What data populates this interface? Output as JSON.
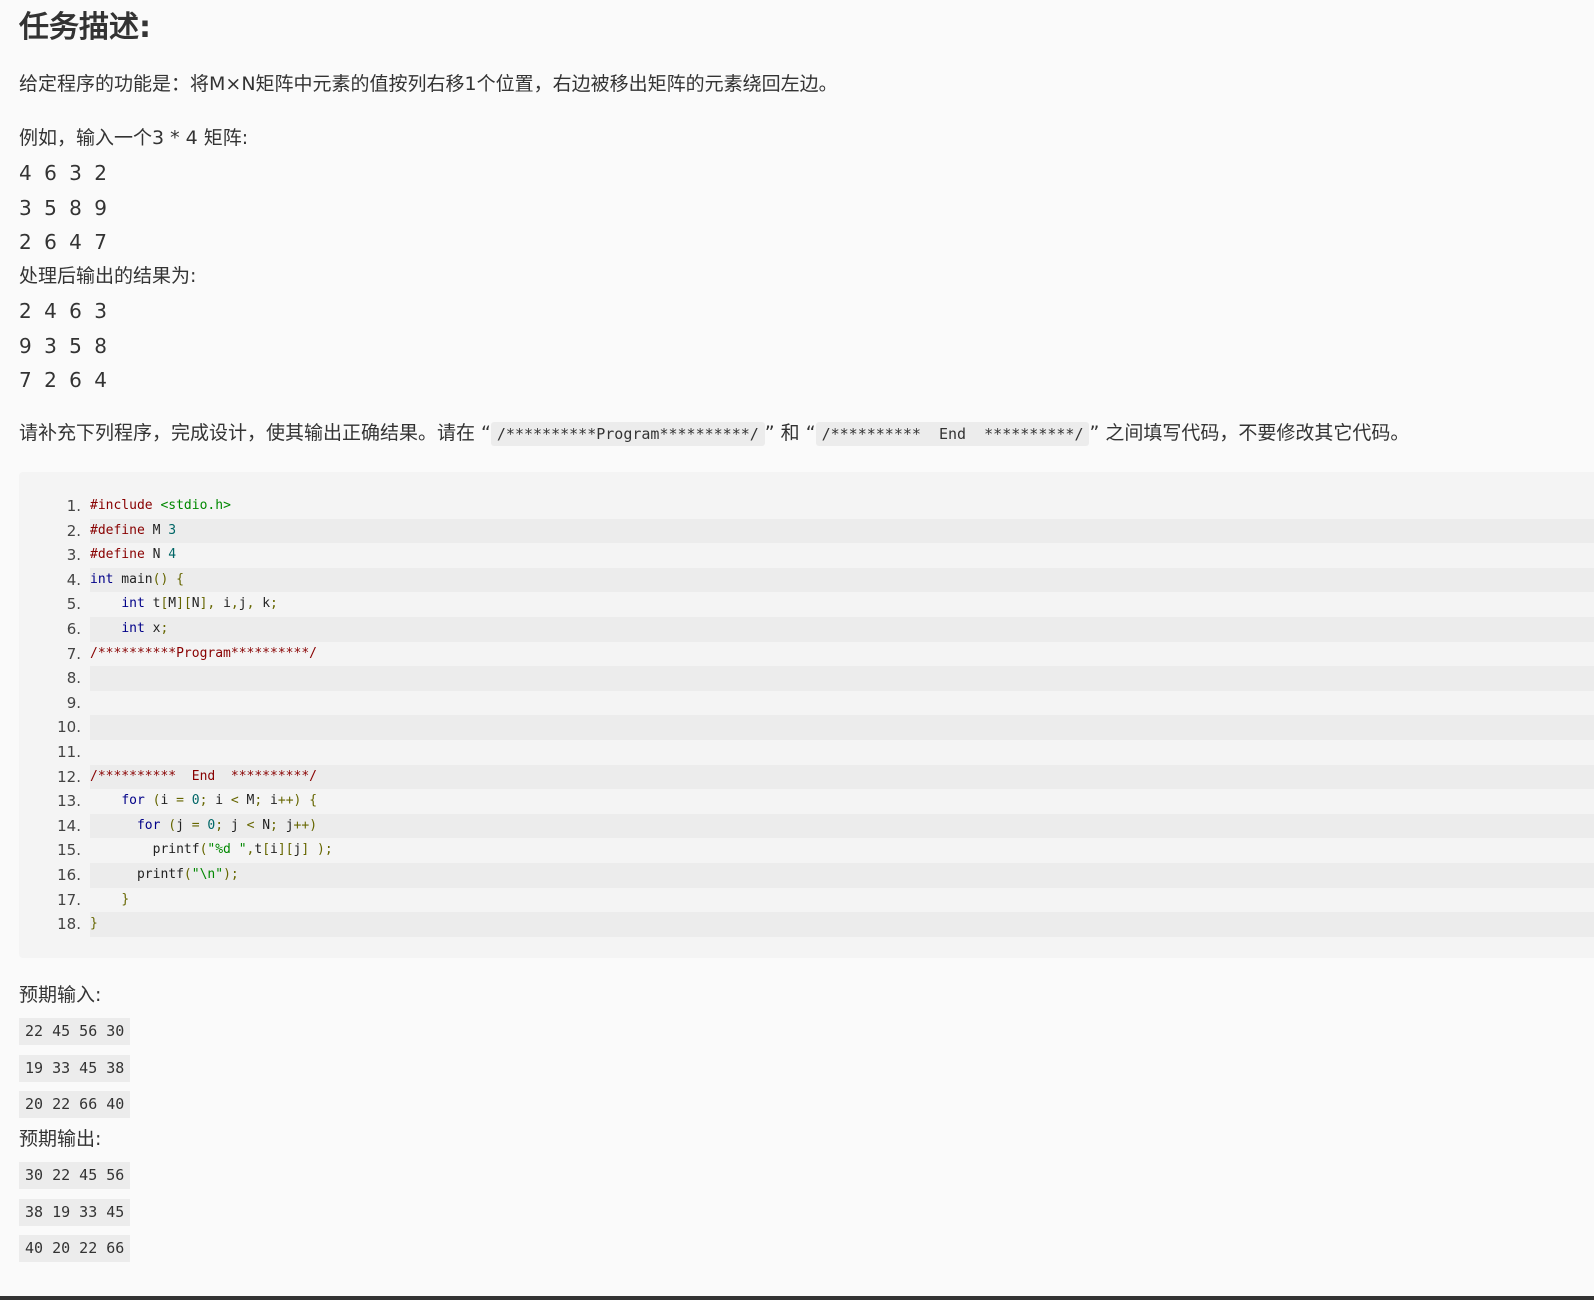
{
  "title": "任务描述:",
  "intro": "给定程序的功能是：将M×N矩阵中元素的值按列右移1个位置，右边被移出矩阵的元素绕回左边。",
  "example_label": "例如，输入一个3 * 4 矩阵:",
  "example_input_rows": [
    "4 6 3 2",
    "3 5 8 9",
    "2 6 4 7"
  ],
  "result_label": "处理后输出的结果为:",
  "example_output_rows": [
    "2 4 6 3",
    "9 3 5 8",
    "7 2 6 4"
  ],
  "instruction": {
    "part1": "请补充下列程序，完成设计，使其输出正确结果。请在 “",
    "code1": "/**********Program**********/",
    "part2": "” 和 “",
    "code2": "/**********  End  **********/",
    "part3": "” 之间填写代码，不要修改其它代码。"
  },
  "code_lines": [
    "#include <stdio.h>",
    "#define M 3",
    "#define N 4",
    "int main() {",
    "    int t[M][N], i,j, k;",
    "    int x;",
    "/**********Program**********/",
    "",
    "",
    "",
    "",
    "/**********  End  **********/",
    "    for (i = 0; i < M; i++) {",
    "      for (j = 0; j < N; j++)",
    "        printf(\"%d \",t[i][j] );",
    "      printf(\"\\n\");",
    "    }",
    "}"
  ],
  "expected_input_label": "预期输入:",
  "expected_input": [
    "22 45 56 30",
    "19 33 45 38",
    "20 22 66 40"
  ],
  "expected_output_label": "预期输出:",
  "expected_output": [
    "30 22 45 56",
    "38 19 33 45",
    "40 20 22 66"
  ]
}
